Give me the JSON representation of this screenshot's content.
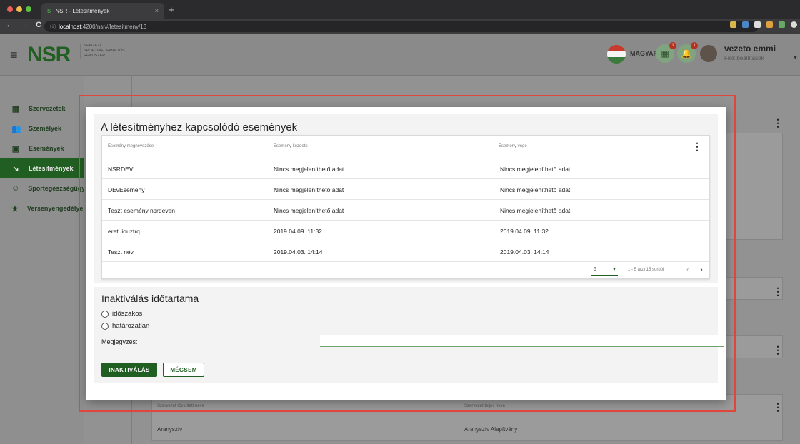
{
  "browser": {
    "traffic_colors": [
      "#ee5f57",
      "#f5be4f",
      "#5ec343"
    ],
    "tab_title": "NSR - Létesítmények",
    "tab_close": "×",
    "new_tab": "+",
    "nav_back": "←",
    "nav_forward": "→",
    "nav_reload": "C",
    "info_icon": "ⓘ",
    "url_host": "localhost",
    "url_path": ":4200/nsr#/letesitmeny/13",
    "extension_colors": [
      "#d8b84a",
      "#4a86c8",
      "#dddddd",
      "#e0a040",
      "#66aa66",
      "#dddddd",
      "#ffffff"
    ]
  },
  "header": {
    "menu_icon": "≡",
    "logo": "NSR",
    "logo_subtitle": [
      "NEMZETI",
      "SPORTINFORMÁCIÓS",
      "RENDSZER"
    ],
    "language": "MAGYAR",
    "language_caret": "⌄",
    "flag_colors": [
      "#c63b2e",
      "#f4f4f4",
      "#3a7a3a"
    ],
    "calc_badge": "1",
    "bell_badge": "1",
    "user_name": "vezeto emmi",
    "user_sub": "Fiók beállítások",
    "user_caret": "▼"
  },
  "sidebar": {
    "items": [
      {
        "label": "Szervezetek",
        "icon": "▦"
      },
      {
        "label": "Személyek",
        "icon": "👥"
      },
      {
        "label": "Események",
        "icon": "▣"
      },
      {
        "label": "Létesítmények",
        "icon": "↘"
      },
      {
        "label": "Sportegészségügy",
        "icon": "☺"
      },
      {
        "label": "Versenyengedélyek",
        "icon": "★"
      }
    ]
  },
  "background": {
    "col1_header": "Szervezet rövidített neve",
    "col2_header": "Szervezet teljes neve",
    "row_col1": "Aranyszív",
    "row_col2": "Aranyszív Alapítvány"
  },
  "dialog": {
    "title": "A létesítményhez kapcsolódó események",
    "columns": [
      "Esemény megnevezése",
      "Esemény kezdete",
      "Esemény vége"
    ],
    "rows": [
      [
        "NSRDEV",
        "Nincs megjeleníthető adat",
        "Nincs megjeleníthető adat"
      ],
      [
        "DEvEsemény",
        "Nincs megjeleníthető adat",
        "Nincs megjeleníthető adat"
      ],
      [
        "Teszt esemény nsrdeven",
        "Nincs megjeleníthető adat",
        "Nincs megjeleníthető adat"
      ],
      [
        "eretuiouztrq",
        "2019.04.09. 11:32",
        "2019.04.09. 11:32"
      ],
      [
        "Teszt név",
        "2019.04.03. 14:14",
        "2019.04.03. 14:14"
      ]
    ],
    "kebab": "⋮",
    "page_size": "5",
    "page_caret": "▼",
    "range_info": "1 - 5 a(z) 15 sorból",
    "prev": "‹",
    "next": "›",
    "inactivation_title": "Inaktiválás időtartama",
    "option_periodic": "időszakos",
    "option_indefinite": "határozatlan",
    "note_label": "Megjegyzés:",
    "note_value": "",
    "inactivate_button": "INAKTIVÁLÁS",
    "cancel_button": "MÉGSEM"
  }
}
